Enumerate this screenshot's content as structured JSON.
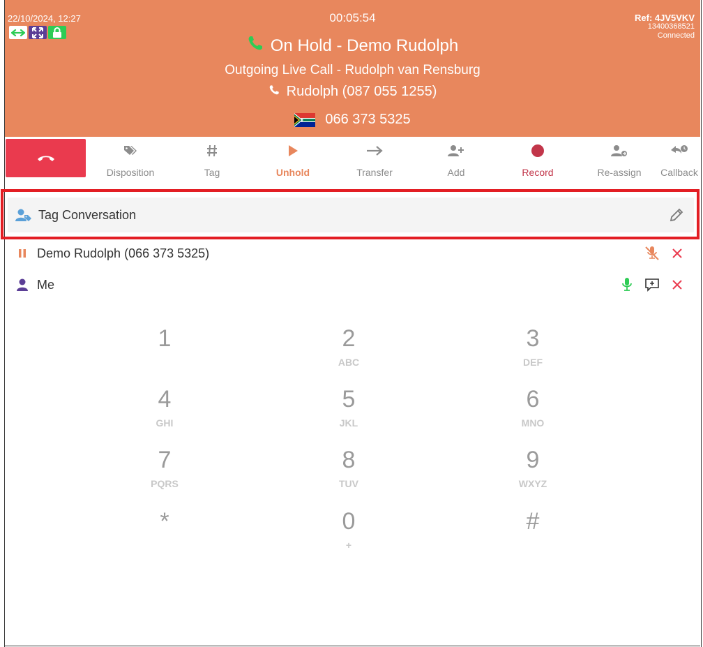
{
  "header": {
    "datetime": "22/10/2024, 12:27",
    "timer": "00:05:54",
    "ref": "Ref: 4JV5VKV",
    "ref_number": "13400368521",
    "connection_status": "Connected",
    "status_line": "On Hold - Demo Rudolph",
    "call_type": "Outgoing Live Call - Rudolph van Rensburg",
    "contact": "Rudolph (087 055 1255)",
    "dialed_number": "066 373 5325",
    "colors": {
      "header_bg": "#e8875d",
      "hangup": "#ea3a4e",
      "accent": "#e8875d"
    }
  },
  "toolbar": {
    "items": [
      {
        "label": "Disposition",
        "icon": "tags-icon"
      },
      {
        "label": "Tag",
        "icon": "hash-icon"
      },
      {
        "label": "Unhold",
        "icon": "play-icon"
      },
      {
        "label": "Transfer",
        "icon": "arrow-right-icon"
      },
      {
        "label": "Add",
        "icon": "user-plus-icon"
      },
      {
        "label": "Record",
        "icon": "record-dot-icon"
      },
      {
        "label": "Re-assign",
        "icon": "user-reassign-icon"
      },
      {
        "label": "Callback",
        "icon": "callback-icon"
      }
    ]
  },
  "tag_conversation": {
    "label": "Tag Conversation"
  },
  "participants": [
    {
      "name": "Demo Rudolph (066 373 5325)",
      "state": "on-hold"
    },
    {
      "name": "Me",
      "state": "active"
    }
  ],
  "keypad": {
    "keys": [
      {
        "digit": "1",
        "letters": ""
      },
      {
        "digit": "2",
        "letters": "ABC"
      },
      {
        "digit": "3",
        "letters": "DEF"
      },
      {
        "digit": "4",
        "letters": "GHI"
      },
      {
        "digit": "5",
        "letters": "JKL"
      },
      {
        "digit": "6",
        "letters": "MNO"
      },
      {
        "digit": "7",
        "letters": "PQRS"
      },
      {
        "digit": "8",
        "letters": "TUV"
      },
      {
        "digit": "9",
        "letters": "WXYZ"
      },
      {
        "digit": "*",
        "letters": ""
      },
      {
        "digit": "0",
        "letters": "+"
      },
      {
        "digit": "#",
        "letters": ""
      }
    ]
  }
}
